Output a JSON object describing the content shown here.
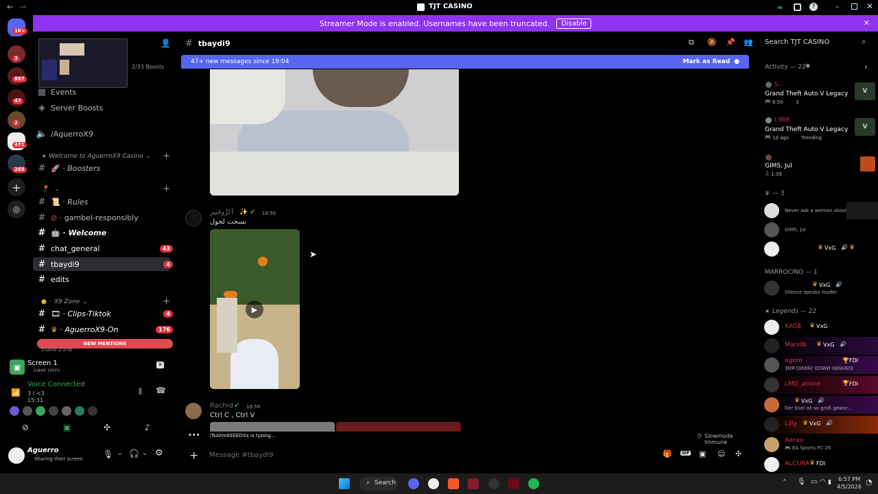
{
  "window": {
    "title": "TJT CASINO"
  },
  "banner": {
    "text": "Streamer Mode is enabled. Usernames have been truncated.",
    "button": "Disable"
  },
  "guild_badges": [
    "1K+",
    "3",
    "897",
    "47",
    "2",
    "471",
    "268"
  ],
  "server": {
    "boosts": "2/33 Boosts"
  },
  "sidebar": {
    "events": "Events",
    "server_boosts": "Server Boosts",
    "vanity": "/AguerroX9",
    "cat1": "Welcome to AguerroX9 Casino",
    "boosters": "Boosters",
    "cat2": "",
    "rules": "Rules",
    "gambel": "gambel-responsibly",
    "welcome": "Welcome",
    "chat_general": "chat_general",
    "chat_general_badge": "43",
    "tbaydi9": "tbaydi9",
    "tbaydi9_badge": "4",
    "edits": "edits",
    "cat3": "X9 Zone",
    "clips": "Clips-Tiktok",
    "clips_badge": "4",
    "aguerro_on": "AguerroX9-On",
    "aguerro_on_badge": "176",
    "new_mentions": "NEW MENTIONS",
    "stake": "Stake Zone"
  },
  "screen_share": {
    "title": "Screen 1",
    "quality": "1080P 30FPS"
  },
  "voice": {
    "status": "Voice Connected",
    "channel": "3 / <3",
    "time": "15:31"
  },
  "user": {
    "name": "Aguerro",
    "status": "Sharing their screen"
  },
  "channel_header": {
    "name": "tbaydi9",
    "search_placeholder": "Search TJT CASINO"
  },
  "new_messages": {
    "text": "47+ new messages since 18:04",
    "action": "Mark as Read"
  },
  "messages": [
    {
      "author": "ٱلرَّوقنير",
      "time": "18:56",
      "text": "بسحت لحول"
    },
    {
      "author": "Rachid",
      "time": "18:56",
      "text": "Ctrl C , Ctrl V"
    }
  ],
  "typing": {
    "text": "iTsAhmEEEEDXx is typing...",
    "slowmode": "Slowmode Immune"
  },
  "composer": {
    "placeholder": "Message #tbaydi9"
  },
  "members": {
    "activity_header": "Activity — 22",
    "activities": [
      {
        "name": "S...",
        "game": "Grand Theft Auto V Legacy",
        "meta1": "6:50",
        "meta2": "3"
      },
      {
        "name": "L'888",
        "game": "Grand Theft Auto V Legacy",
        "meta1": "1d ago",
        "meta2": "Trending"
      },
      {
        "name": "",
        "game": "GIMS, Jul",
        "meta1": "1:39",
        "meta2": ""
      }
    ],
    "group1_header": "— 3",
    "group1": [
      {
        "name": "",
        "status": "Never ask a woman about her ..."
      },
      {
        "name": "",
        "status": "GIMS, Jul"
      },
      {
        "name": "",
        "status": "VxG"
      }
    ],
    "group2_header": "MARROCINO — 1",
    "group2": [
      {
        "name": "VxG",
        "status": "Silence speaks louder"
      }
    ],
    "group3_header": "Legends — 22",
    "group3": [
      {
        "name": "KAGE",
        "tag": "VxG",
        "status": ""
      },
      {
        "name": "MarviN",
        "tag": "VxG",
        "status": ""
      },
      {
        "name": "ogoro",
        "tag": "FDI",
        "status": "ƎHЯ ᗡИƎЯƧ ᗡOWИ ᗡИIAƎƧƎ"
      },
      {
        "name": "LMG_amine",
        "tag": "FDI",
        "status": ""
      },
      {
        "name": "",
        "tag": "VxG",
        "status": "Der Esel ist so groß gewor..."
      },
      {
        "name": "Lilly",
        "tag": "VxG",
        "status": ""
      },
      {
        "name": "Aenzo",
        "tag": "",
        "status": "EA Sports FC 26"
      },
      {
        "name": "ALCURA",
        "tag": "FDI",
        "status": ""
      }
    ]
  },
  "taskbar": {
    "search": "Search",
    "time": "6:57 PM",
    "date": "4/5/2026"
  },
  "colors": {
    "banner": "#8f33f0",
    "blurple": "#5865f2",
    "badge": "#e62e3f",
    "mention": "#e24852"
  }
}
